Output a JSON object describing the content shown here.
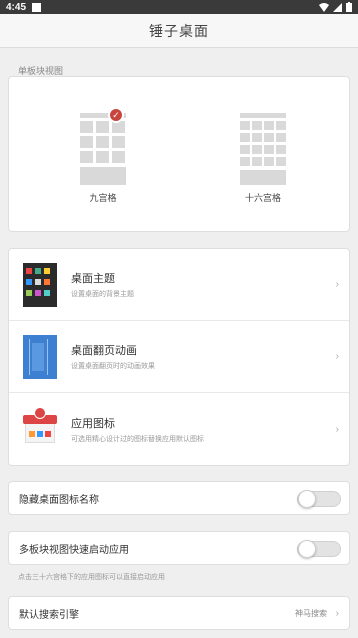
{
  "status": {
    "time": "4:45"
  },
  "header": {
    "title": "锤子桌面"
  },
  "layout_section": {
    "label": "单板块视图",
    "options": [
      {
        "label": "九宫格",
        "selected": true
      },
      {
        "label": "十六宫格",
        "selected": false
      }
    ]
  },
  "settings": [
    {
      "title": "桌面主题",
      "subtitle": "设置桌面的背景主题"
    },
    {
      "title": "桌面翻页动画",
      "subtitle": "设置桌面翻页时的动画效果"
    },
    {
      "title": "应用图标",
      "subtitle": "可选用精心设计过的图标替换应用默认图标"
    }
  ],
  "toggles": {
    "hide_names": {
      "label": "隐藏桌面图标名称",
      "on": false
    },
    "quick_launch": {
      "label": "多板块视图快速启动应用",
      "on": false,
      "hint": "点击三十六宫格下的应用图标可以直接启动应用"
    }
  },
  "search_engine": {
    "label": "默认搜索引擎",
    "value": "神马搜索"
  },
  "colors": {
    "accent": "#c8453e",
    "placeholder": "#d9d9d9"
  }
}
